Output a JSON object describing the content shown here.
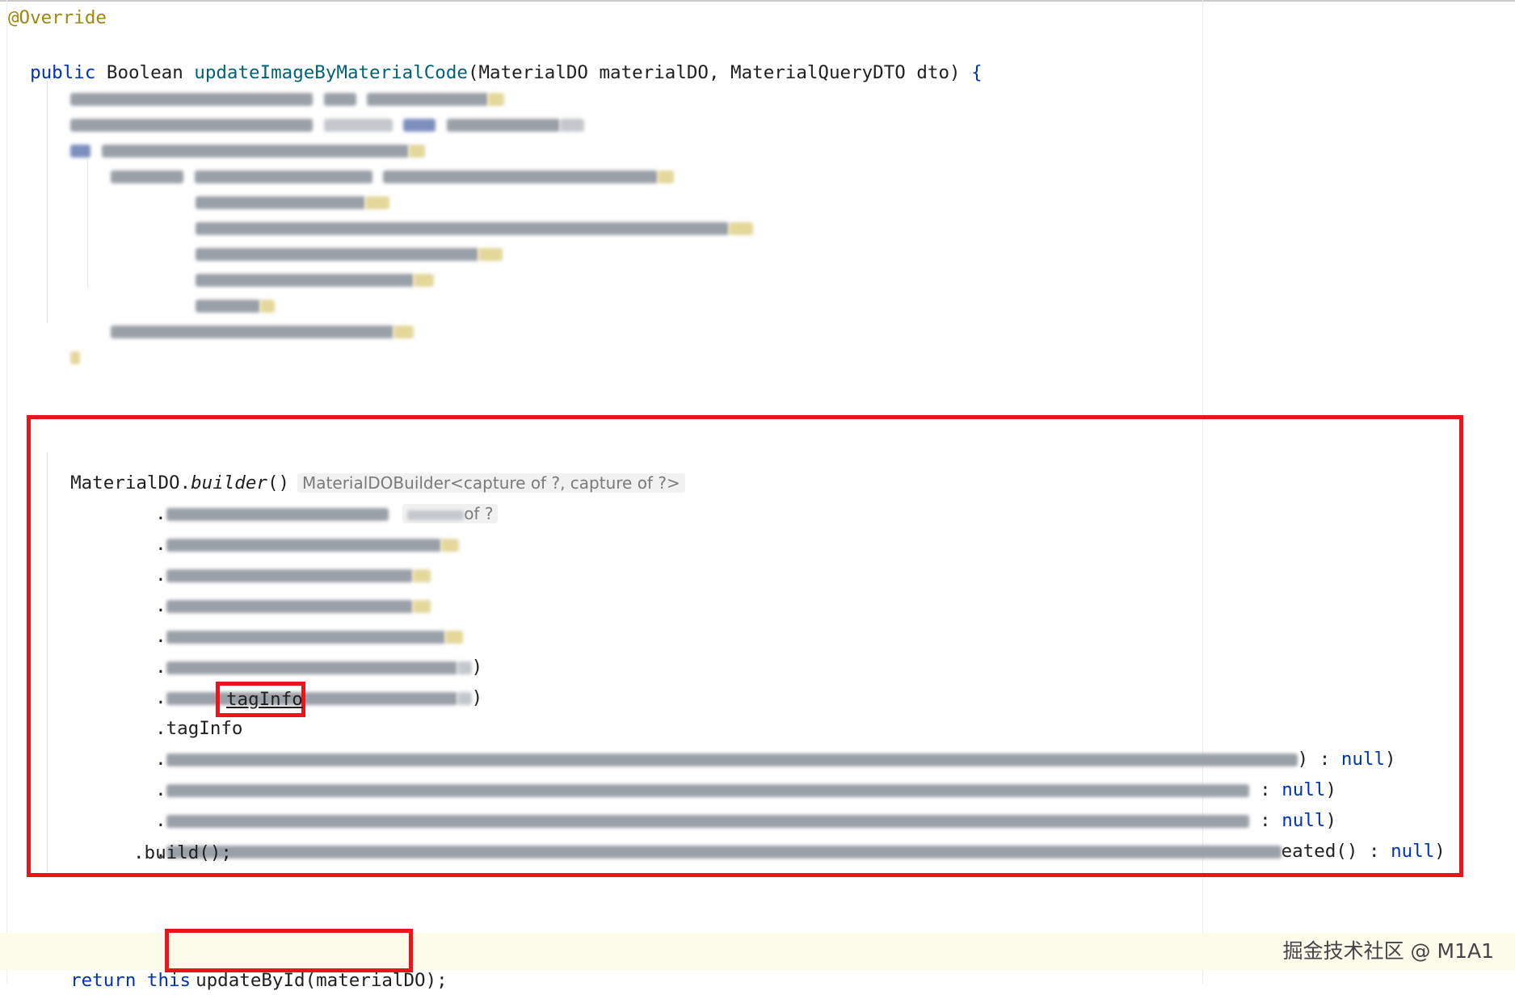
{
  "code": {
    "annotation": "@Override",
    "signature": {
      "modifier": "public",
      "return_type": "Boolean",
      "method_name": "updateImageByMaterialCode",
      "open_paren": "(",
      "params": "MaterialDO materialDO, MaterialQueryDTO dto",
      "close_paren": ")",
      "open_brace": "{"
    },
    "builder": {
      "receiver": "MaterialDO.",
      "method": "builder",
      "parens": "()",
      "type_hint": "MaterialDOBuilder<capture of ?, capture of ?>",
      "hint_tail": "of ?",
      "tag_info_prefix": ".tagInfo",
      "tag_info_arg": "tagInfo",
      "safety_tail": ") : ",
      "safety_null": "null",
      "safety_close": ")",
      "max_tail": " : ",
      "max_null": "null",
      "max_close": ")",
      "lead_tail": " : ",
      "lead_null": "null",
      "lead_close": ")",
      "enable_tail": "eated() : ",
      "enable_null": "null",
      "enable_close": ")",
      "modify_by_close": ")",
      "modify_time_close": ")",
      "build": ".build();"
    },
    "return_stmt": {
      "keyword": "return",
      "this_kw": "this",
      "call": "updateById",
      "open_paren": "(",
      "arg": "materialDO",
      "close": ");"
    }
  },
  "watermark": "掘金技术社区 @ M1A1",
  "colors": {
    "highlight_box": "#e8151b",
    "keyword": "#0033b3",
    "method": "#00627a",
    "annotation": "#9e880d"
  }
}
